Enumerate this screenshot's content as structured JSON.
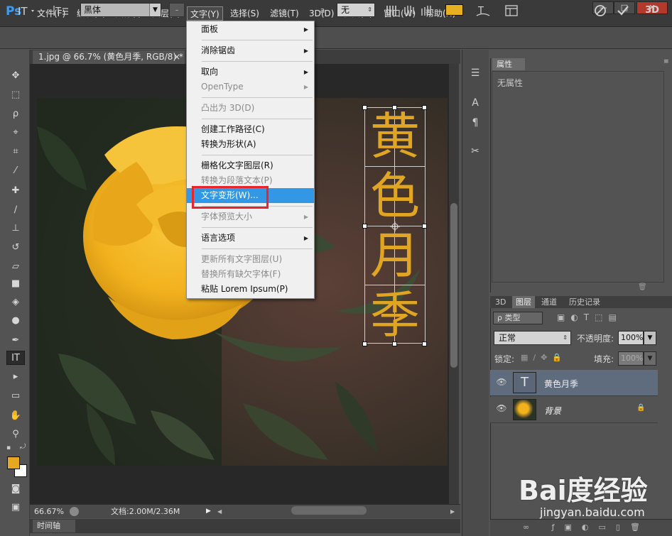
{
  "app": {
    "logo": "Ps"
  },
  "menubar": {
    "items": [
      "文件(F)",
      "编辑(E)",
      "图像(I)",
      "图层(L)",
      "文字(Y)",
      "选择(S)",
      "滤镜(T)",
      "3D(D)",
      "视图(V)",
      "窗口(W)",
      "帮助(H)"
    ],
    "active_index": 4
  },
  "window_controls": {
    "minimize": "—",
    "maximize": "□",
    "close": "✕"
  },
  "options_bar": {
    "font_family": "黑体",
    "font_style": "-",
    "antialias": "无",
    "text_color": "#e6b021",
    "aa_label": "a"
  },
  "document": {
    "tab_title": "1.jpg @ 66.7% (黄色月季, RGB/8) *",
    "tab_close": "×"
  },
  "canvas_text": {
    "chars": [
      "黄",
      "色",
      "月",
      "季"
    ],
    "color": "#e0a522"
  },
  "status_bar": {
    "zoom": "66.67%",
    "doc_info": "文档:2.00M/2.36M"
  },
  "timeline": {
    "tab": "时间轴"
  },
  "properties_panel": {
    "tab": "属性",
    "empty_text": "无属性"
  },
  "layers_panel": {
    "tabs": [
      "3D",
      "图层",
      "通道",
      "历史记录"
    ],
    "active_tab": 1,
    "kind_filter": "ρ 类型",
    "blend_mode": "正常",
    "opacity_label": "不透明度:",
    "opacity_value": "100%",
    "lock_label": "锁定:",
    "fill_label": "填充:",
    "fill_value": "100%",
    "layers": [
      {
        "name": "黄色月季",
        "type": "text",
        "thumb": "T",
        "selected": true
      },
      {
        "name": "背景",
        "type": "image",
        "locked": true,
        "selected": false
      }
    ]
  },
  "text_menu": {
    "items": [
      {
        "label": "面板",
        "submenu": true,
        "disabled": false
      },
      {
        "label": "消除锯齿",
        "submenu": true,
        "disabled": false
      },
      {
        "label": "取向",
        "submenu": true,
        "disabled": false
      },
      {
        "label": "OpenType",
        "submenu": true,
        "disabled": true
      },
      {
        "label": "凸出为 3D(D)",
        "submenu": false,
        "disabled": true
      },
      {
        "label": "创建工作路径(C)",
        "submenu": false,
        "disabled": false
      },
      {
        "label": "转换为形状(A)",
        "submenu": false,
        "disabled": false
      },
      {
        "label": "栅格化文字图层(R)",
        "submenu": false,
        "disabled": false
      },
      {
        "label": "转换为段落文本(P)",
        "submenu": false,
        "disabled": true
      },
      {
        "label": "文字变形(W)...",
        "submenu": false,
        "disabled": false,
        "highlighted": true
      },
      {
        "label": "字体预览大小",
        "submenu": true,
        "disabled": true
      },
      {
        "label": "语言选项",
        "submenu": true,
        "disabled": false
      },
      {
        "label": "更新所有文字图层(U)",
        "submenu": false,
        "disabled": true
      },
      {
        "label": "替换所有缺欠字体(F)",
        "submenu": false,
        "disabled": true
      },
      {
        "label": "粘贴 Lorem Ipsum(P)",
        "submenu": false,
        "disabled": false
      }
    ],
    "submenu_arrow": "▶"
  },
  "watermark": {
    "logo": "Bai度经验",
    "url": "jingyan.baidu.com"
  }
}
